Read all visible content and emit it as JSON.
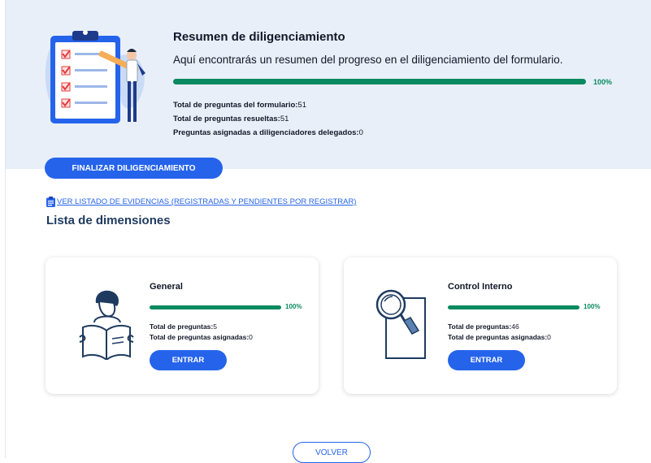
{
  "summary": {
    "title": "Resumen de diligenciamiento",
    "description": "Aquí encontrarás un resumen del progreso en el diligenciamiento del formulario.",
    "progress_label": "100%",
    "progress": 1.0,
    "stats": [
      {
        "label": "Total de preguntas del formulario:",
        "value": "51"
      },
      {
        "label": "Total de preguntas resueltas:",
        "value": "51"
      },
      {
        "label": "Preguntas asignadas a diligenciadores delegados:",
        "value": "0"
      }
    ],
    "finish_button": "FINALIZAR DILIGENCIAMIENTO"
  },
  "evidence_link": "VER LISTADO DE EVIDENCIAS (REGISTRADAS Y PENDIENTES POR REGISTRAR)",
  "dimensions": {
    "title": "Lista de dimensiones",
    "cards": [
      {
        "title": "General",
        "progress_label": "100%",
        "progress": 1.0,
        "total_label": "Total de preguntas:",
        "total_value": "5",
        "assigned_label": "Total de preguntas asignadas:",
        "assigned_value": "0",
        "button": "ENTRAR",
        "icon": "reading-person-icon"
      },
      {
        "title": "Control Interno",
        "progress_label": "100%",
        "progress": 1.0,
        "total_label": "Total de preguntas:",
        "total_value": "46",
        "assigned_label": "Total de preguntas asignadas:",
        "assigned_value": "0",
        "button": "ENTRAR",
        "icon": "magnifier-document-icon"
      }
    ]
  },
  "back_button": "VOLVER",
  "colors": {
    "header_bg": "#e8eff9",
    "primary": "#2563eb",
    "progress": "#0a8a5f"
  }
}
